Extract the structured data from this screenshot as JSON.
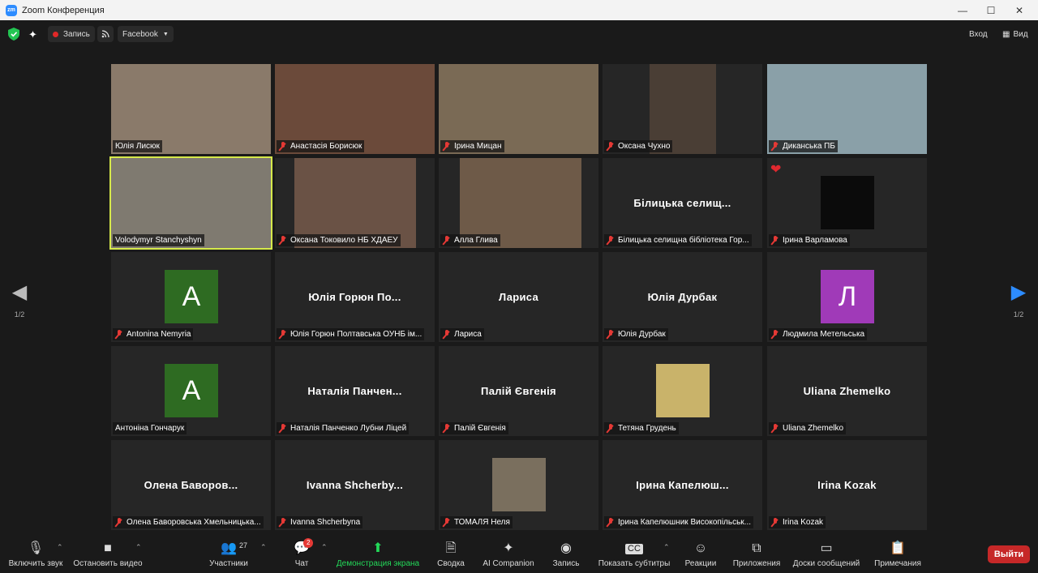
{
  "window": {
    "title": "Zoom Конференция",
    "minimize": "—",
    "maximize": "☐",
    "close": "✕"
  },
  "topbar": {
    "record_label": "Запись",
    "stream_label": "Facebook",
    "signin_label": "Вход",
    "view_label": "Вид"
  },
  "pager": {
    "left": "1/2",
    "right": "1/2"
  },
  "tiles": [
    {
      "name": "Юлія Лисюк",
      "muted": false,
      "video": "#8a7a6a"
    },
    {
      "name": "Анастасія Борисюк",
      "muted": true,
      "video": "#6b4a3a"
    },
    {
      "name": "Ірина Мицан",
      "muted": true,
      "video": "#7a6a55"
    },
    {
      "name": "Оксана Чухно",
      "muted": true,
      "video": "#4a3e35"
    },
    {
      "name": "Диканська ПБ",
      "muted": true,
      "video": "#8aa0a8"
    },
    {
      "name": "Volodymyr Stanchyshyn",
      "muted": false,
      "video": "#7f7a70",
      "active": true
    },
    {
      "name": "Оксана Токовило НБ ХДАЕУ",
      "muted": true,
      "video": "#6a5245"
    },
    {
      "name": "Алла Глива",
      "muted": true,
      "video": "#6e5a48"
    },
    {
      "name": "Білицька селищна бібліотека Гор...",
      "center": "Білицька  селищ...",
      "muted": true
    },
    {
      "name": "Ірина Варламова",
      "muted": true,
      "video": "#0b0b0b",
      "reaction": "❤"
    },
    {
      "name": "Antonina Nemyria",
      "muted": true,
      "avatar": "A",
      "avatar_color": "#2e6b22"
    },
    {
      "name": "Юлія Горюн Полтавська ОУНБ ім...",
      "center": "Юлія  Горюн  По...",
      "muted": true
    },
    {
      "name": "Лариса",
      "center": "Лариса",
      "muted": true
    },
    {
      "name": "Юлія Дурбак",
      "center": "Юлія  Дурбак",
      "muted": true
    },
    {
      "name": "Людмила Метельська",
      "muted": true,
      "avatar": "Л",
      "avatar_color": "#a03ab8"
    },
    {
      "name": "Антоніна Гончарук",
      "muted": false,
      "avatar": "A",
      "avatar_color": "#2e6b22"
    },
    {
      "name": "Наталія Панченко Лубни Ліцей",
      "center": "Наталія  Панчен...",
      "muted": true
    },
    {
      "name": "Палій Євгенія",
      "center": "Палій  Євгенія",
      "muted": true
    },
    {
      "name": "Тетяна Грудень",
      "muted": true,
      "photo": "#c9b36a"
    },
    {
      "name": "Uliana Zhemelko",
      "center": "Uliana  Zhemelko",
      "muted": true
    },
    {
      "name": "Олена Баворовська Хмельницька...",
      "center": "Олена  Баворов...",
      "muted": true
    },
    {
      "name": "Ivanna Shcherbyna",
      "center": "Ivanna  Shcherby...",
      "muted": true
    },
    {
      "name": "ТОМАЛЯ Неля",
      "muted": true,
      "photo": "#7a6f5e"
    },
    {
      "name": "Ірина Капелюшник Високопільськ...",
      "center": "Ірина  Капелюш...",
      "muted": true
    },
    {
      "name": "Irina Kozak",
      "center": "Irina Kozak",
      "muted": true
    }
  ],
  "toolbar": {
    "unmute": "Включить звук",
    "video": "Остановить видео",
    "participants": "Участники",
    "participants_count": "27",
    "chat": "Чат",
    "chat_badge": "2",
    "share": "Демонстрация экрана",
    "summary": "Сводка",
    "ai": "AI Companion",
    "record": "Запись",
    "captions": "Показать субтитры",
    "reactions": "Реакции",
    "apps": "Приложения",
    "whiteboards": "Доски сообщений",
    "notes": "Примечания",
    "leave": "Выйти"
  },
  "colors": {
    "share_green": "#23d959",
    "leave_red": "#c62828",
    "active_border": "#d6e94a"
  }
}
